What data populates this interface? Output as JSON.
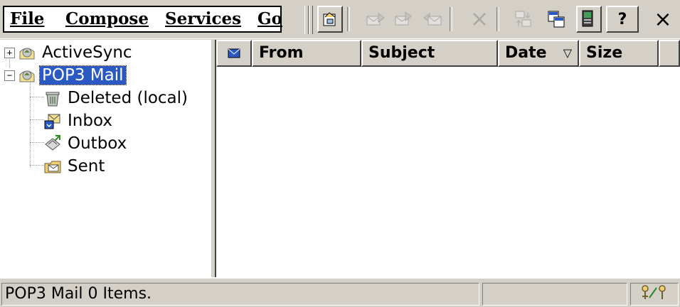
{
  "menu": {
    "file": "File",
    "compose": "Compose",
    "services": "Services",
    "go": "Go"
  },
  "toolbar": {
    "icons": [
      "properties-icon",
      "reply-icon",
      "reply-all-icon",
      "forward-icon",
      "delete-icon",
      "send-receive-icon",
      "copy-folder-icon",
      "connect-icon"
    ],
    "help_label": "?",
    "close_label": "×"
  },
  "folders": {
    "activesync": "ActiveSync",
    "pop3": "POP3 Mail",
    "deleted": "Deleted (local)",
    "inbox": "Inbox",
    "outbox": "Outbox",
    "sent": "Sent",
    "expand_symbol": "+",
    "collapse_symbol": "−"
  },
  "columns": {
    "from": "From",
    "subject": "Subject",
    "date": "Date",
    "size": "Size",
    "sort_indicator": "▽"
  },
  "status": {
    "text": "POP3 Mail 0 Items."
  },
  "colors": {
    "selection": "#2b59c3",
    "chrome": "#d4d0c8"
  }
}
